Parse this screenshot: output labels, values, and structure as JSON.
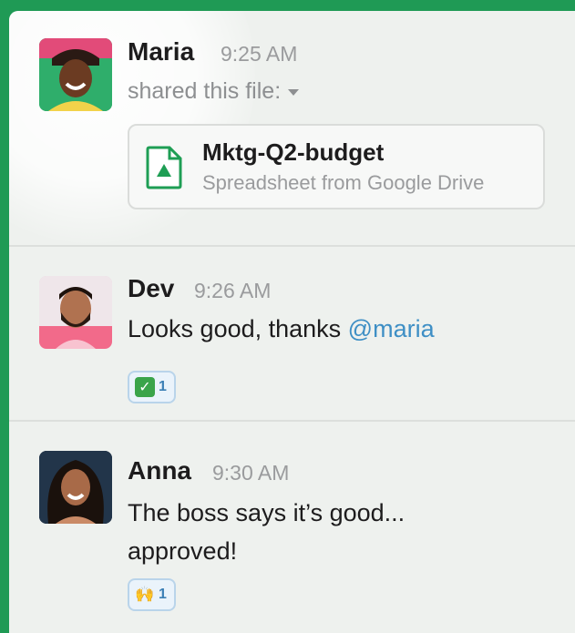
{
  "messages": [
    {
      "author": "Maria",
      "time": "9:25 AM",
      "action": "shared this file:",
      "file": {
        "name": "Mktg-Q2-budget",
        "source": "Spreadsheet from Google Drive"
      }
    },
    {
      "author": "Dev",
      "time": "9:26 AM",
      "text": "Looks good, thanks ",
      "mention": "@maria",
      "reaction": {
        "emoji": "✅",
        "count": "1"
      }
    },
    {
      "author": "Anna",
      "time": "9:30 AM",
      "text_line1": "The boss says it’s good...",
      "text_line2": "approved!",
      "reaction": {
        "emoji": "🙌",
        "count": "1"
      }
    }
  ],
  "colors": {
    "background": "#1f9a55",
    "panel": "#eef1ee",
    "mention": "#3e8fc5",
    "reaction_bg": "#eaf3fb",
    "check_green": "#3aa44a"
  },
  "icons": {
    "file": "google-sheets-file-icon",
    "dropdown": "chevron-down-icon"
  }
}
